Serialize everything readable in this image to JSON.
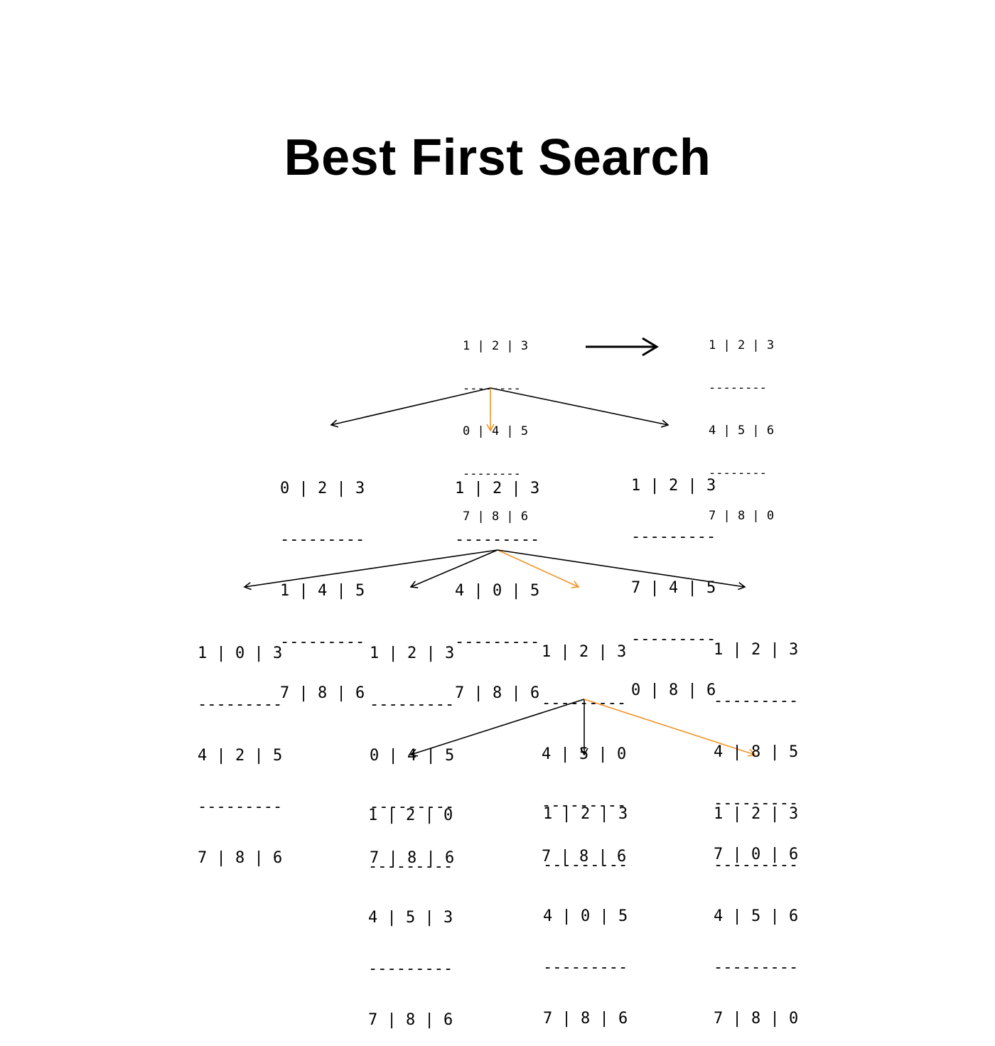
{
  "title": "Best First Search",
  "separator_small": "--------",
  "separator_large": "---------",
  "colors": {
    "default_edge": "#000000",
    "chosen_edge": "#f0952a"
  },
  "nodes": {
    "start": [
      "1 | 2 | 3",
      "0 | 4 | 5",
      "7 | 8 | 6"
    ],
    "goal": [
      "1 | 2 | 3",
      "4 | 5 | 6",
      "7 | 8 | 0"
    ],
    "l1_left": [
      "0 | 2 | 3",
      "1 | 4 | 5",
      "7 | 8 | 6"
    ],
    "l1_mid": [
      "1 | 2 | 3",
      "4 | 0 | 5",
      "7 | 8 | 6"
    ],
    "l1_right": [
      "1 | 2 | 3",
      "7 | 4 | 5",
      "0 | 8 | 6"
    ],
    "l2_a": [
      "1 | 0 | 3",
      "4 | 2 | 5",
      "7 | 8 | 6"
    ],
    "l2_b": [
      "1 | 2 | 3",
      "0 | 4 | 5",
      "7 | 8 | 6"
    ],
    "l2_c": [
      "1 | 2 | 3",
      "4 | 5 | 0",
      "7 | 8 | 6"
    ],
    "l2_d": [
      "1 | 2 | 3",
      "4 | 8 | 5",
      "7 | 0 | 6"
    ],
    "l3_a": [
      "1 | 2 | 0",
      "4 | 5 | 3",
      "7 | 8 | 6"
    ],
    "l3_b": [
      "1 | 2 | 3",
      "4 | 0 | 5",
      "7 | 8 | 6"
    ],
    "l3_c": [
      "1 | 2 | 3",
      "4 | 5 | 6",
      "7 | 8 | 0"
    ]
  }
}
